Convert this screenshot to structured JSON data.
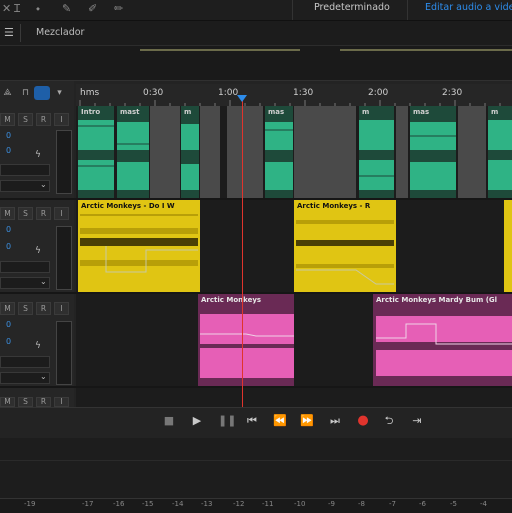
{
  "topbar": {
    "icons": [
      "close-icon",
      "text-cursor-icon",
      "brush-icon",
      "pencil-icon",
      "eraser-icon"
    ],
    "workspace": "Predeterminado",
    "edit_video": "Editar audio a video"
  },
  "mixer": {
    "label": "Mezclador"
  },
  "ruler": {
    "unit": "hms",
    "ticks": [
      "0:30",
      "1:00",
      "1:30",
      "2:00",
      "2:30"
    ]
  },
  "tracks": [
    {
      "buttons": [
        "M",
        "S",
        "R",
        "I"
      ],
      "volume": "0",
      "pan": "0",
      "clips": [
        {
          "title": "Intro",
          "color": "#2fa37a",
          "bg": "#2fa37a"
        },
        {
          "title": "mast",
          "color": "#2fa37a",
          "bg": "#2fa37a"
        },
        {
          "title": "m",
          "color": "#2fa37a",
          "bg": "#2fa37a"
        },
        {
          "title": "mas",
          "color": "#2fa37a",
          "bg": "#2fa37a"
        },
        {
          "title": "m",
          "color": "#2fa37a",
          "bg": "#2fa37a"
        },
        {
          "title": "mas",
          "color": "#2fa37a",
          "bg": "#2fa37a"
        },
        {
          "title": "m",
          "color": "#2fa37a",
          "bg": "#2fa37a"
        }
      ]
    },
    {
      "buttons": [
        "M",
        "S",
        "R",
        "I"
      ],
      "volume": "0",
      "pan": "0",
      "clips": [
        {
          "title": "Arctic Monkeys - Do I W",
          "color": "#e0c513"
        },
        {
          "title": "Arctic Monkeys - R",
          "color": "#e0c513"
        },
        {
          "title": "",
          "color": "#e0c513"
        }
      ]
    },
    {
      "buttons": [
        "M",
        "S",
        "R",
        "I"
      ],
      "volume": "0",
      "pan": "0",
      "clips": [
        {
          "title": "Arctic Monkeys",
          "color": "#e65fb6"
        },
        {
          "title": "Arctic Monkeys    Mardy Bum (Gl",
          "color": "#e65fb6"
        }
      ]
    }
  ],
  "transport": {
    "buttons": [
      "stop",
      "play",
      "pause",
      "go-to-start",
      "rewind",
      "fast-forward",
      "go-to-end",
      "record",
      "loop",
      "skip-selection"
    ]
  },
  "db_scale": [
    "-19",
    "-17",
    "-16",
    "-15",
    "-14",
    "-13",
    "-12",
    "-11",
    "-10",
    "-9",
    "-8",
    "-7",
    "-6",
    "-5",
    "-4"
  ],
  "accent": {
    "playhead": "#e0342d",
    "marker": "#2d8ceb"
  }
}
